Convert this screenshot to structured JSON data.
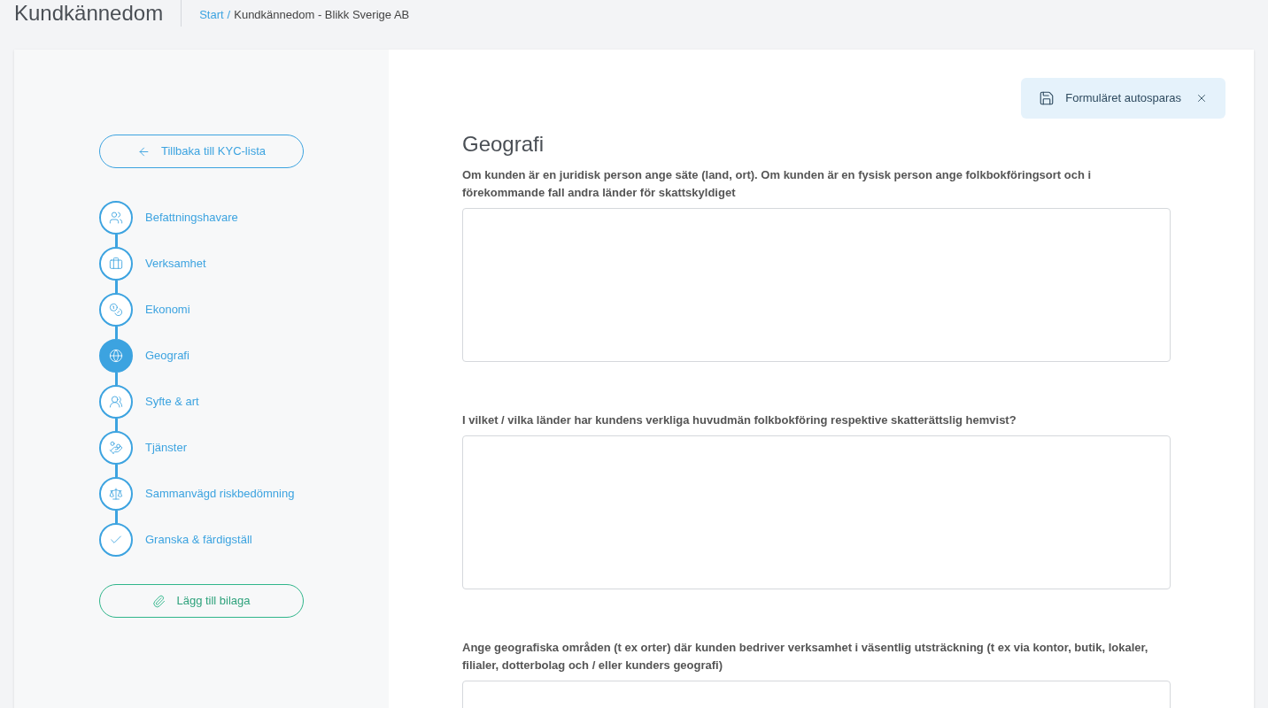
{
  "header": {
    "title": "Kundkännedom",
    "breadcrumb": {
      "link": "Start",
      "separator": "/",
      "current": "Kundkännedom - Blikk Sverige AB"
    }
  },
  "sidebar": {
    "back_button": "Tillbaka till KYC-lista",
    "steps": [
      {
        "kind": "people",
        "label": "Befattningshavare",
        "selected": false
      },
      {
        "kind": "briefcase",
        "label": "Verksamhet",
        "selected": false
      },
      {
        "kind": "coins",
        "label": "Ekonomi",
        "selected": false
      },
      {
        "kind": "globe",
        "label": "Geografi",
        "selected": true
      },
      {
        "kind": "pair",
        "label": "Syfte & art",
        "selected": false
      },
      {
        "kind": "hand",
        "label": "Tjänster",
        "selected": false
      },
      {
        "kind": "scale",
        "label": "Sammanvägd riskbedömning",
        "selected": false
      },
      {
        "kind": "check",
        "label": "Granska & färdigställ",
        "selected": false
      }
    ],
    "attach_button": "Lägg till bilaga"
  },
  "notice": {
    "text": "Formuläret autosparas"
  },
  "form": {
    "title": "Geografi",
    "questions": [
      {
        "label": "Om kunden är en juridisk person ange säte (land, ort). Om kunden är en fysisk person ange folkbokföringsort och i förekommande fall andra länder för skattskyldiget"
      },
      {
        "label": "I vilket / vilka länder har kundens verkliga huvudmän folkbokföring respektive skatterättslig hemvist?"
      },
      {
        "label": "Ange geografiska områden (t ex orter) där kunden bedriver verksamhet i väsentlig utsträckning (t ex via kontor, butik, lokaler, filialer, dotterbolag och / eller kunders geografi)"
      }
    ]
  }
}
